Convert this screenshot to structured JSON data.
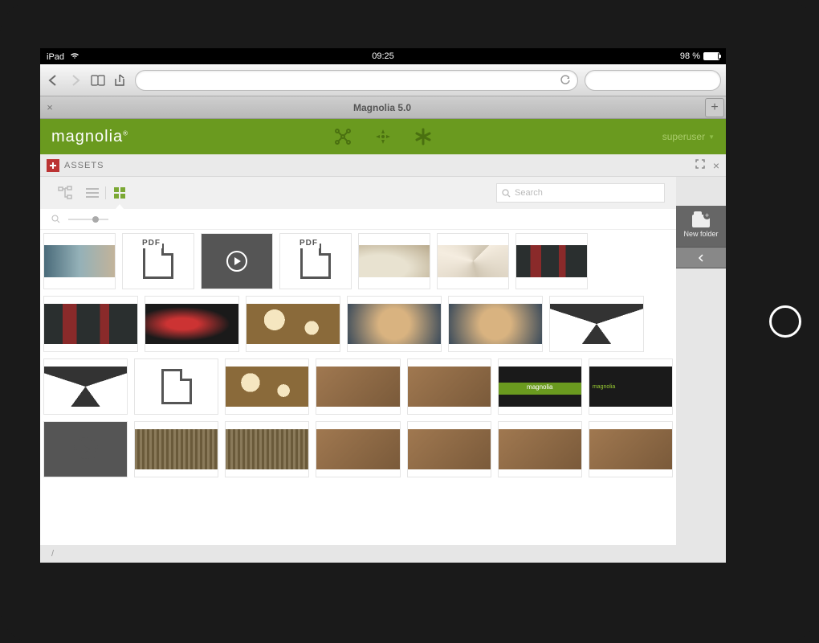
{
  "ios": {
    "device": "iPad",
    "time": "09:25",
    "battery_pct": "98 %"
  },
  "safari": {
    "tab_title": "Magnolia 5.0"
  },
  "header": {
    "brand": "magnolia",
    "brand_trademark": "®",
    "user": "superuser"
  },
  "subheader": {
    "title": "ASSETS"
  },
  "views": {
    "tree": "tree-view",
    "list": "list-view",
    "grid": "grid-view",
    "active": "grid"
  },
  "search": {
    "placeholder": "Search"
  },
  "breadcrumb": {
    "path": "/"
  },
  "rail": {
    "new_folder": "New folder"
  },
  "assets": {
    "row1": [
      {
        "kind": "image",
        "name": "asset-thumbnail",
        "style": "ph1"
      },
      {
        "kind": "pdf",
        "name": "pdf-document",
        "label": "PDF"
      },
      {
        "kind": "video",
        "name": "video-asset"
      },
      {
        "kind": "pdf",
        "name": "pdf-document",
        "label": "PDF"
      },
      {
        "kind": "image",
        "name": "asset-thumbnail",
        "style": "ph-curve"
      },
      {
        "kind": "image",
        "name": "asset-thumbnail",
        "style": "ph-spiral"
      },
      {
        "kind": "image",
        "name": "asset-thumbnail",
        "style": "ph-red"
      }
    ],
    "row2": [
      {
        "kind": "image",
        "name": "asset-thumbnail",
        "style": "ph-red"
      },
      {
        "kind": "image",
        "name": "asset-thumbnail",
        "style": "ph-lamp"
      },
      {
        "kind": "image",
        "name": "asset-thumbnail",
        "style": "ph-bokeh"
      },
      {
        "kind": "image",
        "name": "asset-thumbnail",
        "style": "ph-butterfly"
      },
      {
        "kind": "image",
        "name": "asset-thumbnail",
        "style": "ph-butterfly"
      },
      {
        "kind": "image",
        "name": "asset-thumbnail",
        "style": "ph-struct"
      }
    ],
    "row3": [
      {
        "kind": "image",
        "name": "asset-thumbnail",
        "style": "ph-struct"
      },
      {
        "kind": "file",
        "name": "generic-file"
      },
      {
        "kind": "image",
        "name": "asset-thumbnail",
        "style": "ph-bokeh"
      },
      {
        "kind": "image",
        "name": "asset-thumbnail",
        "style": "ph-brown"
      },
      {
        "kind": "image",
        "name": "asset-thumbnail",
        "style": "ph-brown"
      },
      {
        "kind": "brand",
        "name": "brand-banner",
        "text": "magnolia"
      },
      {
        "kind": "brand2",
        "name": "brand-dark",
        "text": "magnolia"
      }
    ],
    "row4": [
      {
        "kind": "video-outline",
        "name": "video-asset"
      },
      {
        "kind": "image",
        "name": "asset-thumbnail",
        "style": "ph-weave"
      },
      {
        "kind": "image",
        "name": "asset-thumbnail",
        "style": "ph-weave"
      },
      {
        "kind": "image",
        "name": "asset-thumbnail",
        "style": "ph-brown"
      },
      {
        "kind": "image",
        "name": "asset-thumbnail",
        "style": "ph-brown"
      },
      {
        "kind": "image",
        "name": "asset-thumbnail",
        "style": "ph-brown"
      },
      {
        "kind": "image",
        "name": "asset-thumbnail",
        "style": "ph-brown"
      }
    ]
  }
}
